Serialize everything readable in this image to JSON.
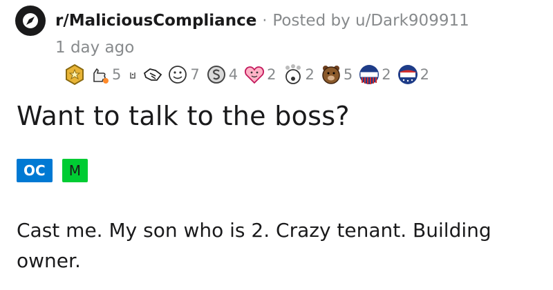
{
  "post": {
    "subreddit": "r/MaliciousCompliance",
    "separator": "·",
    "posted_by": "Posted by u/Dark909911",
    "time_ago": "1 day ago",
    "awards": [
      {
        "icon": "gold-award-icon",
        "count": ""
      },
      {
        "icon": "wholesome-hand-icon",
        "count": "5"
      },
      {
        "icon": "small-award-icon",
        "count": ""
      },
      {
        "icon": "hand-shake-icon",
        "count": ""
      },
      {
        "icon": "tongue-face-icon",
        "count": "7"
      },
      {
        "icon": "silver-coin-icon",
        "count": "4"
      },
      {
        "icon": "heart-face-icon",
        "count": "2"
      },
      {
        "icon": "mind-blown-icon",
        "count": "2"
      },
      {
        "icon": "bear-icon",
        "count": "5"
      },
      {
        "icon": "voted-badge-icon",
        "count": "2"
      },
      {
        "icon": "vote-badge-icon",
        "count": "2"
      }
    ],
    "title": "Want to talk to the boss?",
    "flairs": [
      {
        "label": "OC",
        "color": "#0079d3"
      },
      {
        "label": "M",
        "color": "#00cc33"
      }
    ],
    "body": "Cast me. My son who is 2. Crazy tenant. Building owner."
  }
}
